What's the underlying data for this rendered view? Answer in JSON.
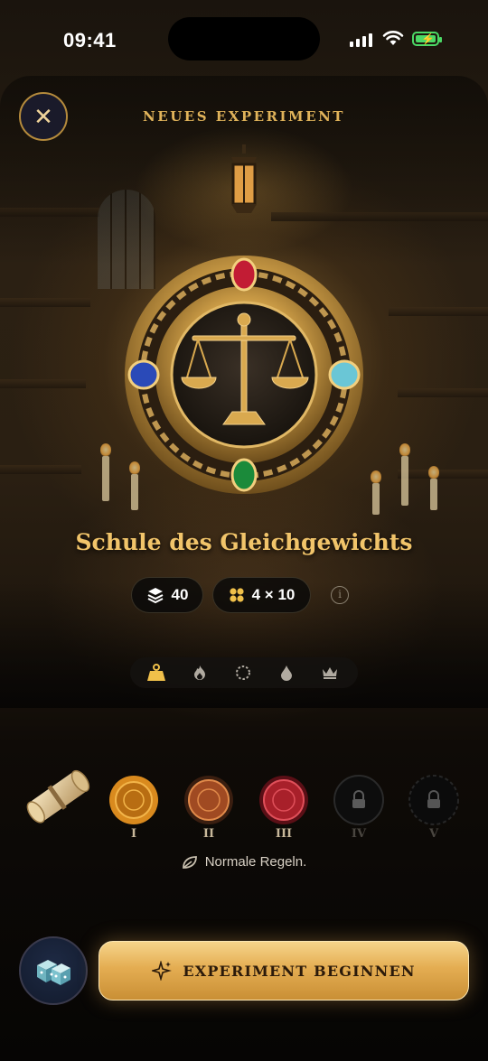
{
  "status_bar": {
    "time": "09:41"
  },
  "header": {
    "title": "NEUES EXPERIMENT",
    "close_icon": "close-icon"
  },
  "experiment": {
    "name": "Schule des Gleichgewichts",
    "emblem_icon": "balance-scale-icon",
    "stats": [
      {
        "icon": "layers-icon",
        "value": "40"
      },
      {
        "icon": "grid-dots-icon",
        "value": "4 × 10"
      }
    ],
    "info_icon": "info-icon"
  },
  "tabs": [
    {
      "icon": "weight-icon",
      "active": true
    },
    {
      "icon": "flame-icon",
      "active": false
    },
    {
      "icon": "ring-icon",
      "active": false
    },
    {
      "icon": "drop-icon",
      "active": false
    },
    {
      "icon": "crown-icon",
      "active": false
    }
  ],
  "levels": {
    "scroll_icon": "scroll-icon",
    "seals": [
      {
        "label": "I",
        "locked": false,
        "color": "#d98a1e"
      },
      {
        "label": "II",
        "locked": false,
        "color": "#a04a22"
      },
      {
        "label": "III",
        "locked": false,
        "color": "#a8202a"
      },
      {
        "label": "IV",
        "locked": true,
        "color": "#1a1a1a"
      },
      {
        "label": "V",
        "locked": true,
        "color": "#141414"
      }
    ],
    "rules_icon": "leaf-icon",
    "rules_text": "Normale Regeln."
  },
  "footer": {
    "dice_icon": "dice-icon",
    "begin_label": "EXPERIMENT BEGINNEN",
    "begin_icon": "sparkle-icon"
  },
  "colors": {
    "accent_gold": "#e0b35a",
    "button_gold": "#e4ad52",
    "battery": "#4bd865"
  }
}
